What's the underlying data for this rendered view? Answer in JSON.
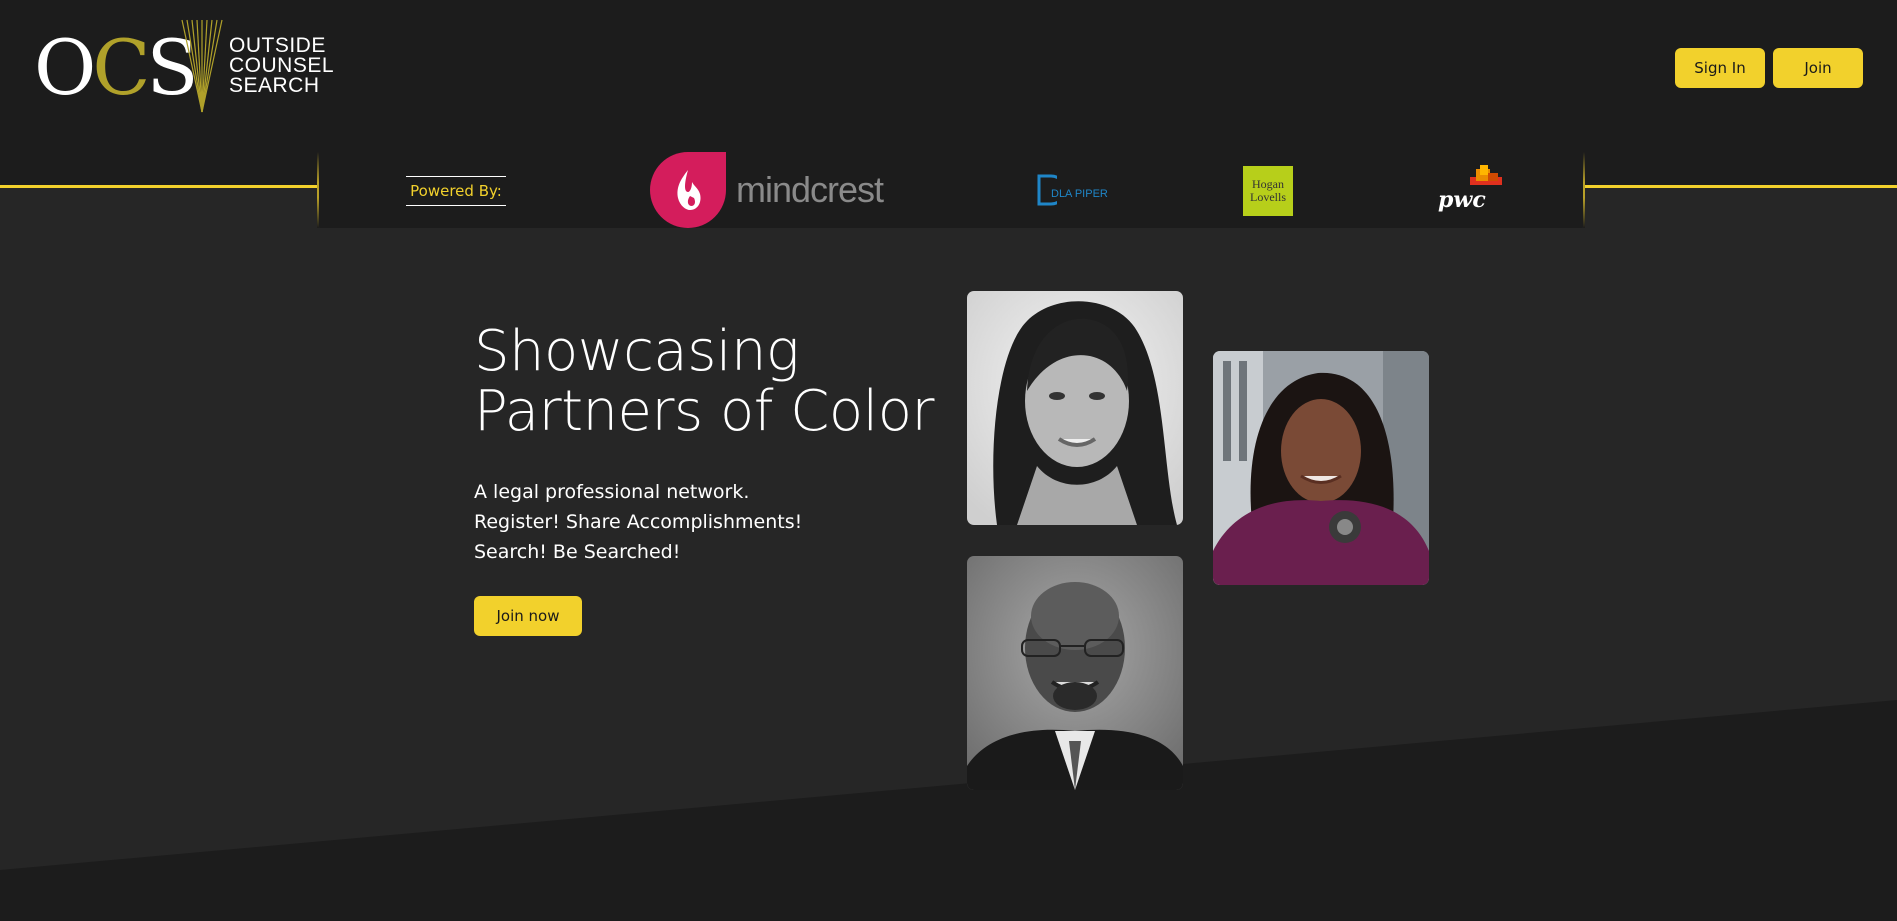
{
  "brand": {
    "logo_letters": "OCS",
    "logo_line1": "OUTSIDE",
    "logo_line2": "COUNSEL",
    "logo_line3": "SEARCH",
    "accent_color": "#f2d12c",
    "gold_color": "#b0a12a"
  },
  "header": {
    "signin_label": "Sign In",
    "join_label": "Join"
  },
  "partners": {
    "powered_label": "Powered By:",
    "mindcrest": "mindcrest",
    "dla_piper": "DLA PIPER",
    "hogan_line1": "Hogan",
    "hogan_line2": "Lovells",
    "pwc": "pwc"
  },
  "hero": {
    "title_line1": "Showcasing",
    "title_line2": "Partners of Color",
    "sub_line1": "A legal professional network.",
    "sub_line2": "Register! Share Accomplishments!",
    "sub_line3": "Search! Be Searched!",
    "cta_label": "Join now"
  },
  "photos": [
    {
      "icon": "portrait-woman-bw"
    },
    {
      "icon": "portrait-woman-color"
    },
    {
      "icon": "portrait-man-bw"
    }
  ]
}
